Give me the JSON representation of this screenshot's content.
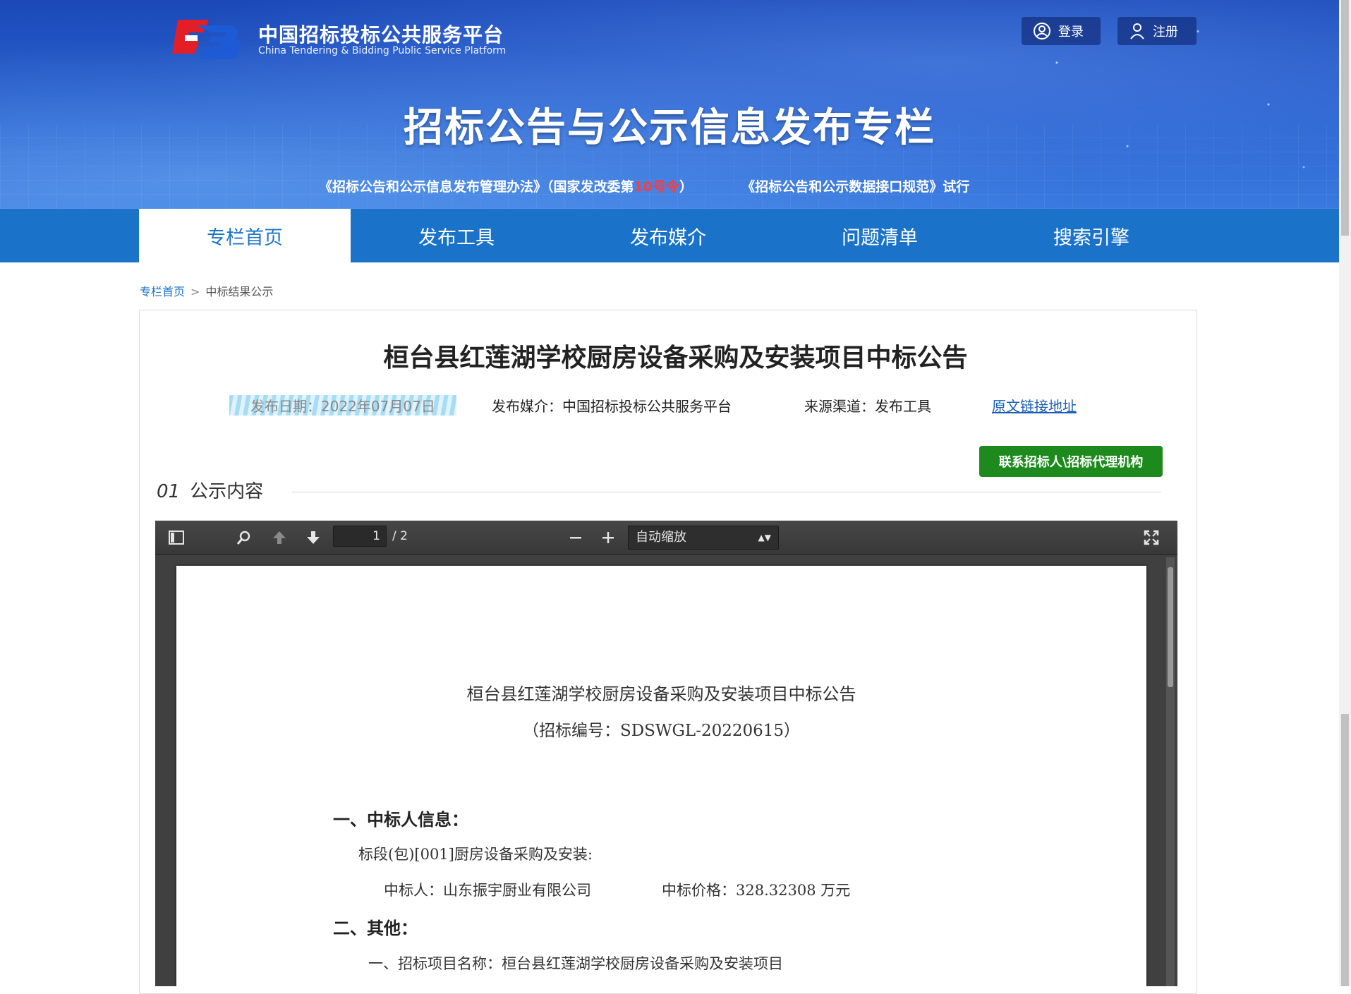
{
  "header": {
    "logo_cn": "中国招标投标公共服务平台",
    "logo_en": "China Tendering & Bidding Public Service Platform",
    "login_label": "登录",
    "register_label": "注册",
    "banner_title": "招标公告与公示信息发布专栏",
    "link1_prefix": "《招标公告和公示信息发布管理办法》（国家发改委第",
    "link1_highlight": "10号令",
    "link1_suffix": "）",
    "link2": "《招标公告和公示数据接口规范》试行"
  },
  "nav": {
    "items": [
      {
        "label": "专栏首页",
        "active": true
      },
      {
        "label": "发布工具",
        "active": false
      },
      {
        "label": "发布媒介",
        "active": false
      },
      {
        "label": "问题清单",
        "active": false
      },
      {
        "label": "搜索引擎",
        "active": false
      }
    ]
  },
  "breadcrumb": {
    "home": "专栏首页",
    "separator": ">",
    "current": "中标结果公示"
  },
  "article": {
    "title": "桓台县红莲湖学校厨房设备采购及安装项目中标公告",
    "date": "发布日期：2022年07月07日",
    "media": "发布媒介：中国招标投标公共服务平台",
    "source": "来源渠道：发布工具",
    "original_link": "原文链接地址",
    "contact_button": "联系招标人\\招标代理机构",
    "section_num": "01",
    "section_title": "公示内容"
  },
  "pdf_viewer": {
    "page_current": "1",
    "page_total": "/ 2",
    "zoom_label": "自动缩放",
    "doc": {
      "title": "桓台县红莲湖学校厨房设备采购及安装项目中标公告",
      "subtitle": "（招标编号：SDSWGL-20220615）",
      "h1": "一、中标人信息：",
      "lot": "标段(包)[001]厨房设备采购及安装:",
      "winner": "中标人：山东振宇厨业有限公司",
      "price": "中标价格：328.32308 万元",
      "h2": "二、其他：",
      "project": "一、招标项目名称：桓台县红莲湖学校厨房设备采购及安装项目"
    }
  }
}
